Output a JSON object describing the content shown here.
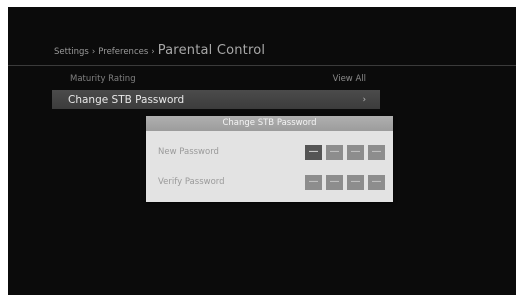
{
  "breadcrumb": {
    "settings": "Settings",
    "preferences": "Preferences",
    "current": "Parental Control",
    "separator": "›"
  },
  "menu": {
    "items": [
      {
        "label": "Maturity Rating",
        "value": "View All"
      },
      {
        "label": "Change STB Password",
        "value": "›"
      }
    ]
  },
  "dialog": {
    "title": "Change STB Password",
    "new_password_label": "New Password",
    "verify_password_label": "Verify Password",
    "new_password_digits": [
      "—",
      "—",
      "—",
      "—"
    ],
    "verify_password_digits": [
      "—",
      "—",
      "—",
      "—"
    ]
  },
  "colors": {
    "screen_background": "#0b0b0b",
    "highlight_row": "#444444",
    "dialog_background": "#e3e3e3",
    "pin_box": "#8d8d8d",
    "pin_box_active": "#555555"
  }
}
